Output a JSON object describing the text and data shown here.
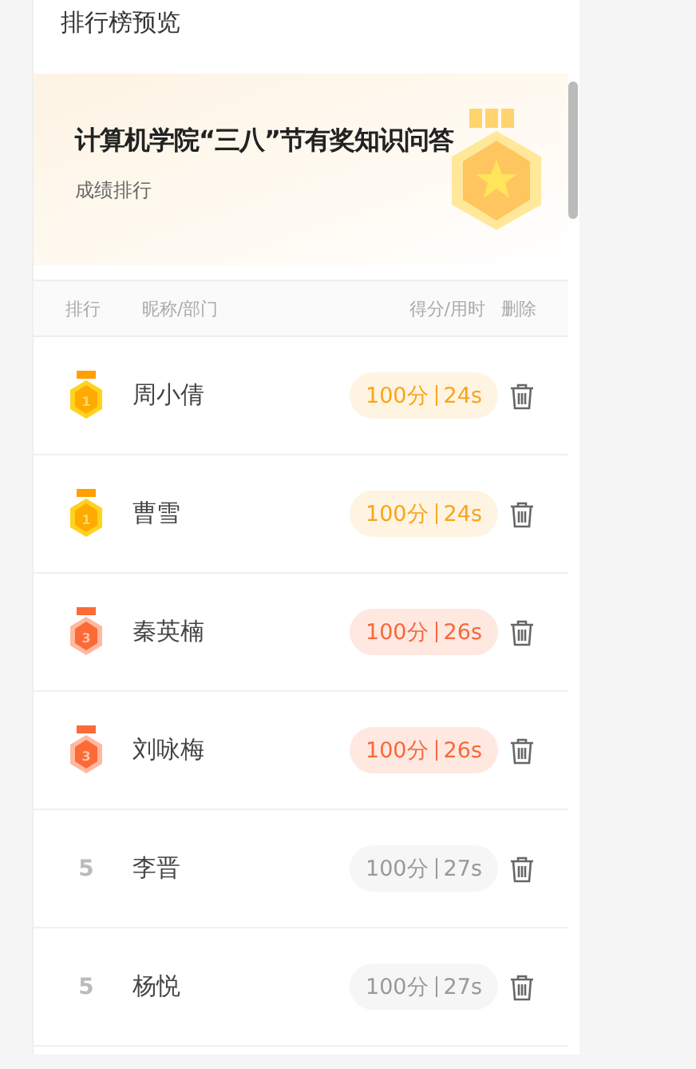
{
  "page_title": "排行榜预览",
  "banner": {
    "title": "计算机学院“三八”节有奖知识问答",
    "subtitle": "成绩排行"
  },
  "columns": {
    "rank": "排行",
    "name": "昵称/部门",
    "score": "得分/用时",
    "delete": "删除"
  },
  "rows": [
    {
      "kind": "gold",
      "rank": "1",
      "name": "周小倩",
      "score": "100分",
      "time": "24s"
    },
    {
      "kind": "gold",
      "rank": "1",
      "name": "曹雪",
      "score": "100分",
      "time": "24s"
    },
    {
      "kind": "bronze",
      "rank": "3",
      "name": "秦英楠",
      "score": "100分",
      "time": "26s"
    },
    {
      "kind": "bronze",
      "rank": "3",
      "name": "刘咏梅",
      "score": "100分",
      "time": "26s"
    },
    {
      "kind": "plain",
      "rank": "5",
      "name": "李晋",
      "score": "100分",
      "time": "27s"
    },
    {
      "kind": "plain",
      "rank": "5",
      "name": "杨悦",
      "score": "100分",
      "time": "27s"
    }
  ]
}
